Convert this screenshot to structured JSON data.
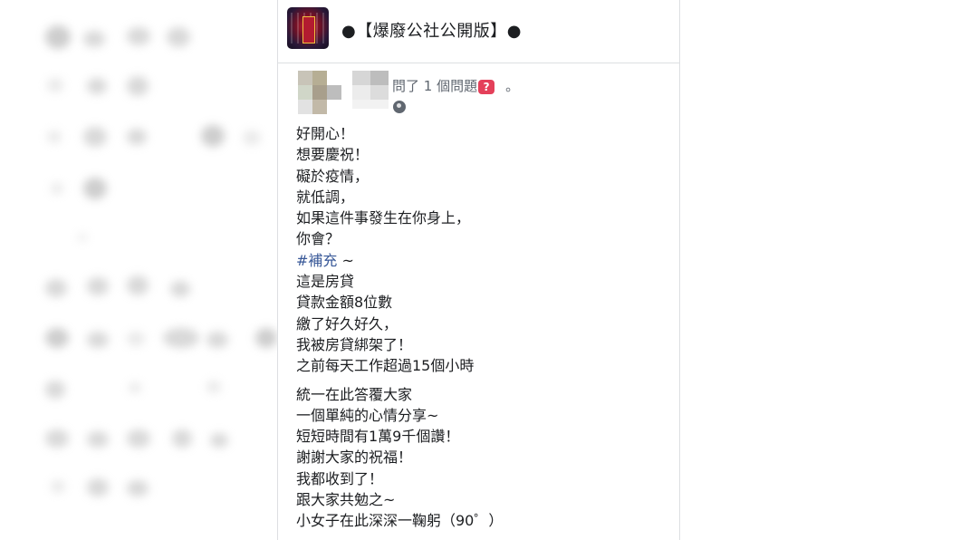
{
  "group": {
    "title": "●【爆廢公社公開版】●",
    "icon": "group-avatar"
  },
  "post": {
    "asked_text": "問了 1 個問題",
    "question_badge": "?",
    "period": "。",
    "privacy_icon": "globe-icon",
    "lines_part1": [
      "好開心！",
      "想要慶祝！",
      "礙於疫情，",
      "就低調，",
      "如果這件事發生在你身上，",
      "你會？"
    ],
    "hashtag": "#補充",
    "hashtag_suffix": "~",
    "lines_part2": [
      "這是房貸",
      "貸款金額8位數",
      "繳了好久好久，",
      "我被房貸綁架了！",
      "之前每天工作超過15個小時"
    ],
    "lines_part3": [
      "統一在此答覆大家",
      "一個單純的心情分享~",
      "短短時間有1萬9千個讚！",
      "謝謝大家的祝福！",
      "我都收到了！",
      "跟大家共勉之~",
      "小女子在此深深一鞠躬（90゜）"
    ]
  },
  "colors": {
    "hashtag": "#385898",
    "badge": "#e4405a",
    "text": "#1c1e21",
    "meta": "#606770"
  }
}
